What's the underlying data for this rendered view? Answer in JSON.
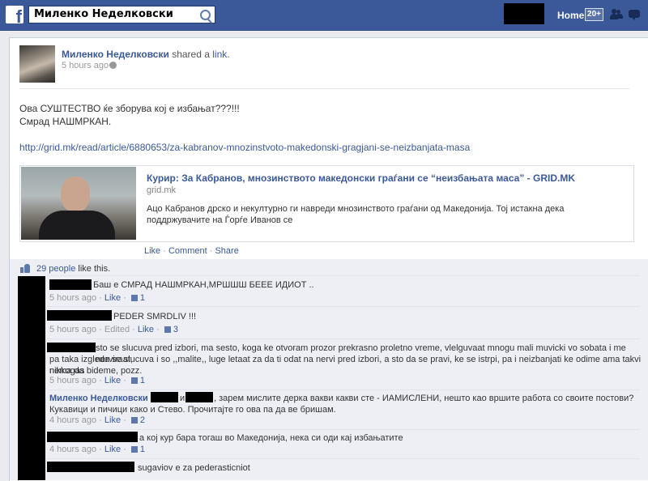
{
  "topbar": {
    "logo": "f",
    "search_value": "Миленко Неделковски",
    "home_label": "Home",
    "home_count": "20+"
  },
  "post": {
    "author": "Миленко Неделковски",
    "shared_text": "shared a",
    "link_word": "link.",
    "time": "5 hours ago",
    "line1": "Ова СУШТЕСТВО ќе зборува кој е избањат???!!!",
    "line2": "Смрад НАШМРКАН.",
    "url": "http://grid.mk/read/article/6880653/za-kabranov-mnozinstvoto-makedonski-gragjani-se-neizbanjata-masa",
    "preview": {
      "title": "Курир: За Кабранов, мнозинството македонски граѓани се “неизбањата маса” - GRID.MK",
      "domain": "grid.mk",
      "description": "Ацо Кабранов дрско и некултурно ги навреди мнозинството граѓани од Македонија. Тој истакна дека поддржувачите на Ѓорѓе Иванов се"
    },
    "actions": {
      "like": "Like",
      "comment": "Comment",
      "share": "Share",
      "separator": "·"
    }
  },
  "likes": {
    "count_link": "29 people",
    "suffix": "like this."
  },
  "comments": [
    {
      "text": "Баш е СМРАД НАШМРКАН,МРШШШ БЕЕЕ ИДИОТ ..",
      "time": "5 hours ago",
      "like": "Like",
      "likes": "1"
    },
    {
      "text": "PEDER SMRDLIV !!!",
      "time": "5 hours ago",
      "edited": "Edited",
      "like": "Like",
      "likes": "3"
    },
    {
      "line1": "sto se slucuva pred izbori, ma sesto, koga ke otvoram prozor prekrasno proletno vreme, vlelguvaat mnogu mali muvicki vo sobata i me nerviraat,",
      "line2": "pa taka izgleda se slucuva i so ,,malite,, luge letaat za da ti odat na nervi pred izbori, a sto da se pravi, ke se istrpi, pa i neizbanjati ke odime ama takvi nikkogas",
      "line3": "nema da bideme, pozz.",
      "time": "5 hours ago",
      "like": "Like",
      "likes": "1"
    },
    {
      "author": "Миленко Неделковски",
      "conj": "и",
      "line1": ", зарем мислите дерка вакви какви сте - ИАМИСЛЕНИ, нешто као вршите работа со своите постови?",
      "line2": "Кукавици и пичици како и Стево. Прочитајте го ова па да ве бришам.",
      "time": "4 hours ago",
      "like": "Like",
      "likes": "2"
    },
    {
      "text": "а кој кур бара тогаш во Македонија, нека си оди кај избањатите",
      "time": "4 hours ago",
      "like": "Like",
      "likes": "1"
    },
    {
      "text": "sugaviov e za pederasticniot"
    }
  ],
  "colors": {
    "brand": "#3b5998",
    "link": "#3b5998",
    "redaction": "#000000",
    "ufi_background": "#edeff4"
  },
  "icons": [
    "facebook-logo-icon",
    "search-icon",
    "friend-requests-icon",
    "messages-icon",
    "notifications-globe-icon",
    "thumbs-up-icon",
    "globe-privacy-icon"
  ]
}
